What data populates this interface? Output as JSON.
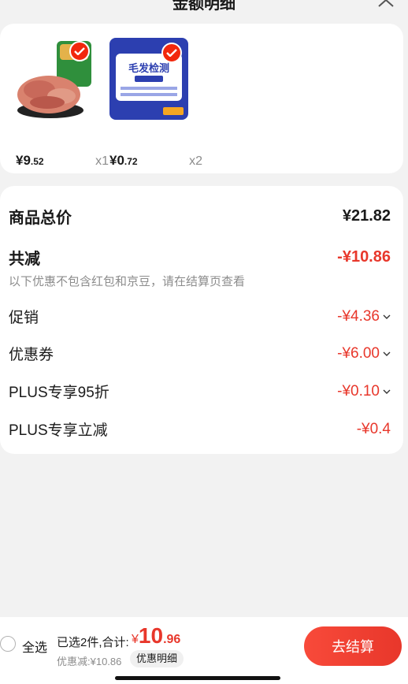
{
  "header": {
    "title": "金额明细"
  },
  "products": [
    {
      "price_int": "¥9",
      "price_dec": ".52",
      "qty": "x1",
      "image": "meat-product-image"
    },
    {
      "price_int": "¥0",
      "price_dec": ".72",
      "qty": "x2",
      "image": "hair-test-product-image",
      "image_text": "毛发检测"
    }
  ],
  "summary": {
    "total_label": "商品总价",
    "total_value": "¥21.82",
    "reduce_label": "共减",
    "reduce_value": "-¥10.86",
    "note": "以下优惠不包含红包和京豆，请在结算页查看",
    "items": [
      {
        "label": "促销",
        "value": "-¥4.36",
        "expandable": true
      },
      {
        "label": "优惠券",
        "value": "-¥6.00",
        "expandable": true
      },
      {
        "label": "PLUS专享95折",
        "value": "-¥0.10",
        "expandable": true
      },
      {
        "label": "PLUS专享立减",
        "value": "-¥0.4",
        "expandable": false
      }
    ]
  },
  "bottom": {
    "select_all": "全选",
    "selected_text": "已选2件,合计:",
    "total_currency": "¥",
    "total_int": "10",
    "total_dec": ".96",
    "discount_text": "优惠减:¥10.86",
    "detail_label": "优惠明细",
    "checkout_label": "去结算"
  },
  "colors": {
    "accent": "#e8372b",
    "check": "#f2270c"
  }
}
